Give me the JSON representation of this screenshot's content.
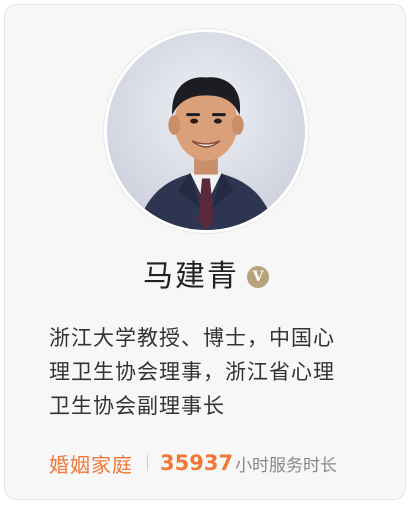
{
  "expert": {
    "name": "马建青",
    "verified_badge": "V",
    "bio": "浙江大学教授、博士，中国心\n理卫生协会理事，浙江省心理\n卫生协会副理事长",
    "category": "婚姻家庭",
    "service_hours": "35937",
    "service_hours_label": "小时服务时长"
  },
  "colors": {
    "accent": "#f07838",
    "badge": "#b8a27c"
  },
  "icons": {
    "verified": "verified-badge-icon"
  }
}
